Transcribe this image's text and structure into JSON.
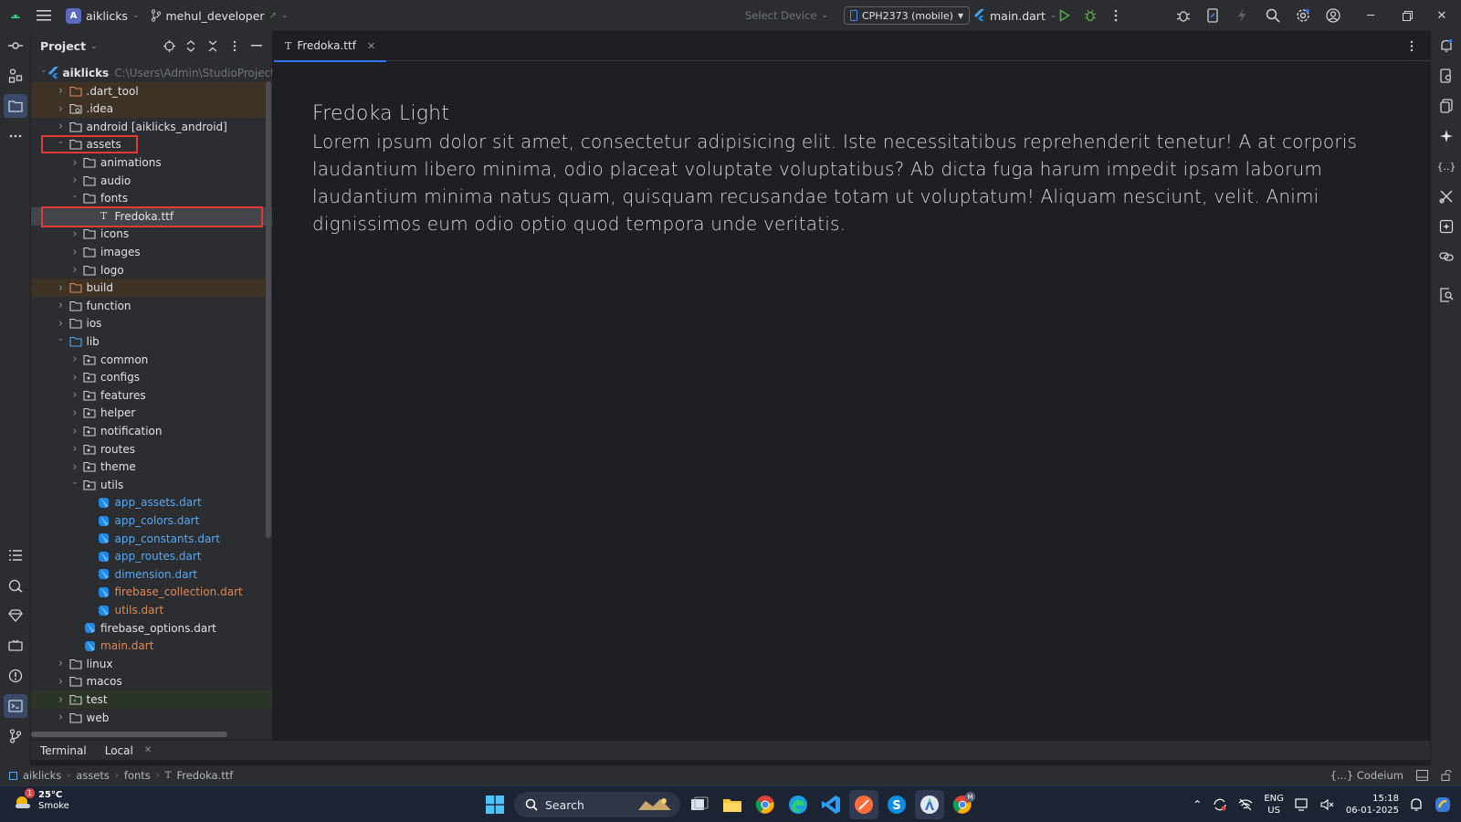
{
  "titlebar": {
    "project_badge": "A",
    "project_name": "aiklicks",
    "branch": "mehul_developer",
    "select_device": "Select Device",
    "device": "CPH2373 (mobile)",
    "run_config": "main.dart"
  },
  "project_panel": {
    "title": "Project",
    "tree": [
      {
        "label": "aiklicks",
        "path": "C:\\Users\\Admin\\StudioProjects\\aik",
        "depth": 0,
        "expanded": true,
        "kind": "module",
        "style": "bold"
      },
      {
        "label": ".dart_tool",
        "depth": 1,
        "expanded": false,
        "kind": "folder-orange",
        "bg": "orange"
      },
      {
        "label": ".idea",
        "depth": 1,
        "expanded": false,
        "kind": "folder-settings",
        "bg": "orange"
      },
      {
        "label": "android [aiklicks_android]",
        "depth": 1,
        "expanded": false,
        "kind": "folder"
      },
      {
        "label": "assets",
        "depth": 1,
        "expanded": true,
        "kind": "folder"
      },
      {
        "label": "animations",
        "depth": 2,
        "expanded": false,
        "kind": "folder"
      },
      {
        "label": "audio",
        "depth": 2,
        "expanded": false,
        "kind": "folder"
      },
      {
        "label": "fonts",
        "depth": 2,
        "expanded": true,
        "kind": "folder"
      },
      {
        "label": "Fredoka.ttf",
        "depth": 3,
        "kind": "font",
        "bg": "selected"
      },
      {
        "label": "icons",
        "depth": 2,
        "expanded": false,
        "kind": "folder"
      },
      {
        "label": "images",
        "depth": 2,
        "expanded": false,
        "kind": "folder"
      },
      {
        "label": "logo",
        "depth": 2,
        "expanded": false,
        "kind": "folder"
      },
      {
        "label": "build",
        "depth": 1,
        "expanded": false,
        "kind": "folder-orange",
        "bg": "orange"
      },
      {
        "label": "function",
        "depth": 1,
        "expanded": false,
        "kind": "folder"
      },
      {
        "label": "ios",
        "depth": 1,
        "expanded": false,
        "kind": "folder"
      },
      {
        "label": "lib",
        "depth": 1,
        "expanded": true,
        "kind": "folder-blue"
      },
      {
        "label": "common",
        "depth": 2,
        "expanded": false,
        "kind": "folder-pkg"
      },
      {
        "label": "configs",
        "depth": 2,
        "expanded": false,
        "kind": "folder-pkg"
      },
      {
        "label": "features",
        "depth": 2,
        "expanded": false,
        "kind": "folder-pkg"
      },
      {
        "label": "helper",
        "depth": 2,
        "expanded": false,
        "kind": "folder-pkg"
      },
      {
        "label": "notification",
        "depth": 2,
        "expanded": false,
        "kind": "folder-pkg"
      },
      {
        "label": "routes",
        "depth": 2,
        "expanded": false,
        "kind": "folder-pkg"
      },
      {
        "label": "theme",
        "depth": 2,
        "expanded": false,
        "kind": "folder-pkg"
      },
      {
        "label": "utils",
        "depth": 2,
        "expanded": true,
        "kind": "folder-pkg"
      },
      {
        "label": "app_assets.dart",
        "depth": 3,
        "kind": "dart",
        "color": "blue"
      },
      {
        "label": "app_colors.dart",
        "depth": 3,
        "kind": "dart",
        "color": "blue"
      },
      {
        "label": "app_constants.dart",
        "depth": 3,
        "kind": "dart",
        "color": "blue"
      },
      {
        "label": "app_routes.dart",
        "depth": 3,
        "kind": "dart",
        "color": "blue"
      },
      {
        "label": "dimension.dart",
        "depth": 3,
        "kind": "dart",
        "color": "blue"
      },
      {
        "label": "firebase_collection.dart",
        "depth": 3,
        "kind": "dart",
        "color": "orange"
      },
      {
        "label": "utils.dart",
        "depth": 3,
        "kind": "dart",
        "color": "orange"
      },
      {
        "label": "firebase_options.dart",
        "depth": 2,
        "kind": "dart",
        "color": "default"
      },
      {
        "label": "main.dart",
        "depth": 2,
        "kind": "dart",
        "color": "orange"
      },
      {
        "label": "linux",
        "depth": 1,
        "expanded": false,
        "kind": "folder"
      },
      {
        "label": "macos",
        "depth": 1,
        "expanded": false,
        "kind": "folder"
      },
      {
        "label": "test",
        "depth": 1,
        "expanded": false,
        "kind": "folder-test",
        "bg": "green"
      },
      {
        "label": "web",
        "depth": 1,
        "expanded": false,
        "kind": "folder"
      }
    ]
  },
  "editor": {
    "tab_label": "Fredoka.ttf",
    "font_name": "Fredoka Light",
    "sample_text": "Lorem ipsum dolor sit amet, consectetur adipisicing elit. Iste necessitatibus reprehenderit tenetur! A at corporis laudantium libero minima, odio placeat voluptate voluptatibus? Ab dicta fuga harum impedit ipsam laborum laudantium minima natus quam, quisquam recusandae totam ut voluptatum! Aliquam nesciunt, velit. Animi dignissimos eum odio optio quod tempora unde veritatis."
  },
  "terminal": {
    "title": "Terminal",
    "tab": "Local"
  },
  "statusbar": {
    "breadcrumbs": [
      "aiklicks",
      "assets",
      "fonts",
      "Fredoka.ttf"
    ],
    "codeium": "{...} Codeium"
  },
  "taskbar": {
    "weather_badge": "1",
    "temperature": "25°C",
    "condition": "Smoke",
    "search_label": "Search",
    "lang_top": "ENG",
    "lang_bottom": "US",
    "time": "15:18",
    "date": "06-01-2025",
    "chrome_badge": "M"
  },
  "colors": {
    "accent": "#3574f0",
    "highlight_box": "#e53935",
    "dart_blue": "#56a8f5",
    "modified_orange": "#e08855"
  }
}
